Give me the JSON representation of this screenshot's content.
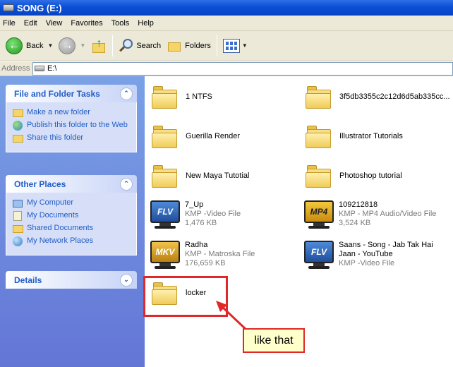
{
  "window": {
    "title": "SONG (E:)"
  },
  "menu": [
    "File",
    "Edit",
    "View",
    "Favorites",
    "Tools",
    "Help"
  ],
  "toolbar": {
    "back": "Back",
    "search": "Search",
    "folders": "Folders"
  },
  "address": {
    "label": "Address",
    "value": "E:\\"
  },
  "left_panels": {
    "tasks": {
      "title": "File and Folder Tasks",
      "items": [
        "Make a new folder",
        "Publish this folder to the Web",
        "Share this folder"
      ]
    },
    "places": {
      "title": "Other Places",
      "items": [
        "My Computer",
        "My Documents",
        "Shared Documents",
        "My Network Places"
      ]
    },
    "details": {
      "title": "Details"
    }
  },
  "files": [
    {
      "name": "1 NTFS",
      "kind": "folder"
    },
    {
      "name": "3f5db3355c2c12d6d5ab335cc...",
      "kind": "folder"
    },
    {
      "name": "Guerilla Render",
      "kind": "folder"
    },
    {
      "name": "Illustrator Tutorials",
      "kind": "folder"
    },
    {
      "name": "New Maya Tutotial",
      "kind": "folder"
    },
    {
      "name": "Photoshop tutorial",
      "kind": "folder"
    },
    {
      "name": "7_Up",
      "type": "KMP -Video File",
      "size": "1,476 KB",
      "badge": "FLV"
    },
    {
      "name": "109212818",
      "type": "KMP - MP4 Audio/Video File",
      "size": "3,524 KB",
      "badge": "MP4"
    },
    {
      "name": "Radha",
      "type": "KMP - Matroska File",
      "size": "176,659 KB",
      "badge": "MKV"
    },
    {
      "name": "Saans - Song - Jab Tak Hai Jaan - YouTube",
      "type": "KMP -Video File",
      "badge": "FLV"
    },
    {
      "name": "locker",
      "kind": "folder"
    }
  ],
  "annotation": {
    "callout_text": "like that",
    "color": "#e02828"
  },
  "colors": {
    "titlebar": "#0a4fd6",
    "taskpane": "#6375d6",
    "link": "#215dc6"
  }
}
